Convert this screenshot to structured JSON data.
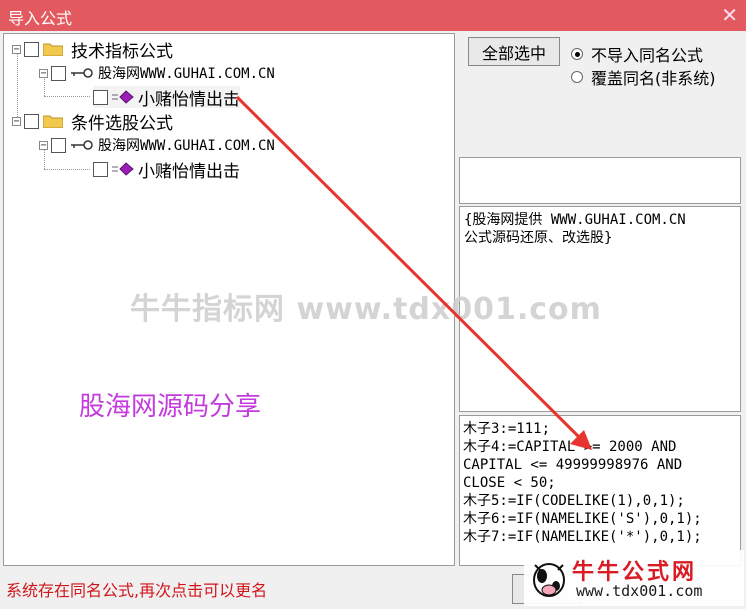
{
  "window": {
    "title": "导入公式",
    "close_glyph": "✕"
  },
  "tree": {
    "group1": {
      "label": "技术指标公式",
      "child": "股海网WWW.GUHAI.COM.CN",
      "leaf": "小赌怡情出击"
    },
    "group2": {
      "label": "条件选股公式",
      "child": "股海网WWW.GUHAI.COM.CN",
      "leaf": "小赌怡情出击"
    }
  },
  "controls": {
    "select_all": "全部选中",
    "radio_no_import": "不导入同名公式",
    "radio_overwrite": "覆盖同名(非系统)",
    "selected": "no_import"
  },
  "description": "{股海网提供 WWW.GUHAI.COM.CN\n公式源码还原、改选股}",
  "code": "木子3:=111;\n木子4:=CAPITAL >= 2000 AND\nCAPITAL <= 49999998976 AND\nCLOSE < 50;\n木子5:=IF(CODELIKE(1),0,1);\n木子6:=IF(NAMELIKE('S'),0,1);\n木子7:=IF(NAMELIKE('*'),0,1);",
  "status": "系统存在同名公式,再次点击可以更名",
  "overlay": {
    "watermark": "牛牛指标网 www.tdx001.com",
    "share_text": "股海网源码分享",
    "logo_title": "牛牛公式网",
    "logo_url": "www.tdx001.com"
  },
  "colors": {
    "titlebar": "#e25a5f",
    "status": "#d0161b",
    "share": "#c33bdc",
    "arrow": "#e8342e"
  }
}
